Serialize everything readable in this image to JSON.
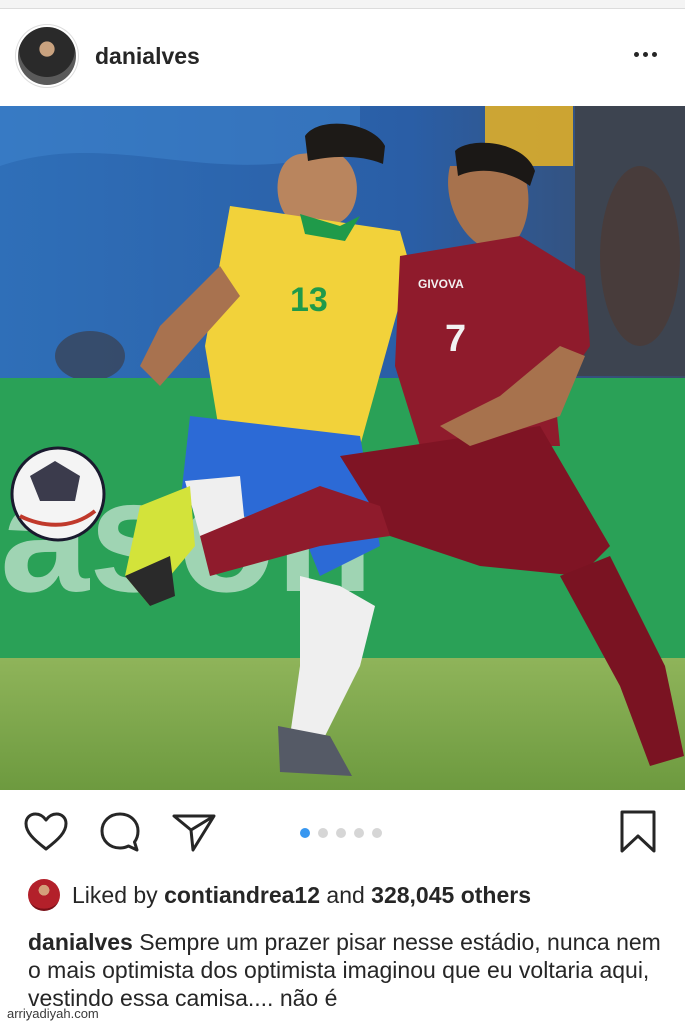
{
  "post": {
    "username": "danialves",
    "more_label": "More options"
  },
  "carousel": {
    "total": 5,
    "active_index": 0
  },
  "photo": {
    "jersey_left_number": "13",
    "jersey_right_number": "7",
    "sponsor_text": "GIVOVA",
    "board_text": "ason"
  },
  "likes": {
    "prefix": "Liked by ",
    "user": "contiandrea12",
    "middle": " and ",
    "count": "328,045 others"
  },
  "caption": {
    "username": "danialves",
    "text": " Sempre um prazer pisar nesse estádio, nunca nem o mais optimista dos optimista imaginou que eu voltaria aqui, vestindo essa camisa.... não é"
  },
  "watermark": "arriyadiyah.com",
  "colors": {
    "accent": "#3897f0",
    "text": "#262626",
    "dot_inactive": "#d6d6d6"
  }
}
